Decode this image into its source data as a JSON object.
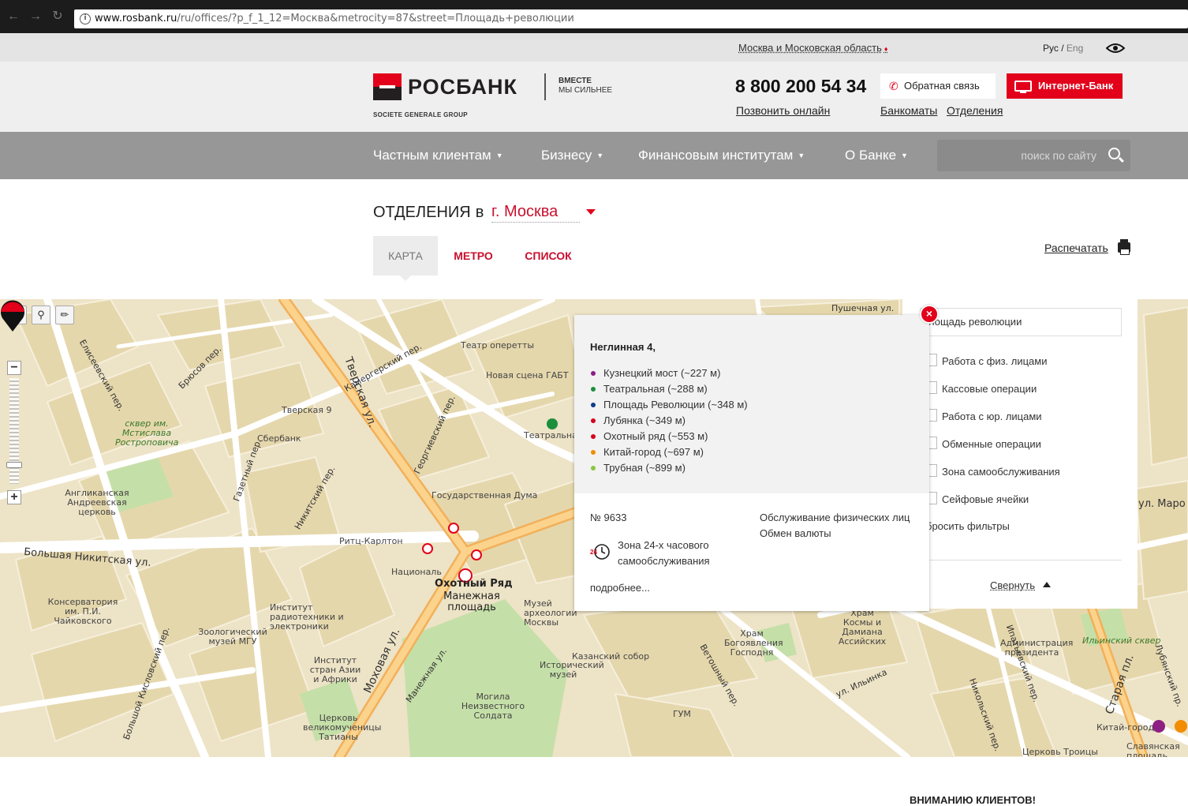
{
  "browser": {
    "url_host": "www.rosbank.ru",
    "url_path": "/ru/offices/?p_f_1_12=Москва&metrocity=87&street=Площадь+революции"
  },
  "topbar": {
    "region": "Москва и Московская область",
    "lang_ru": "Рус",
    "lang_sep": " / ",
    "lang_en": "Eng"
  },
  "header": {
    "logo_text": "РОСБАНК",
    "logo_sub": "SOCIETE GENERALE GROUP",
    "slogan_line1": "ВМЕСТЕ",
    "slogan_line2": "МЫ СИЛЬНЕЕ",
    "phone": "8 800 200 54 34",
    "call_online": "Позвонить онлайн",
    "callback": "Обратная связь",
    "internet_bank": "Интернет-Банк",
    "atms": "Банкоматы",
    "offices": "Отделения"
  },
  "nav": {
    "items": [
      "Частным клиентам",
      "Бизнесу",
      "Финансовым институтам",
      "О Банке"
    ],
    "search_placeholder": "поиск по сайту"
  },
  "page": {
    "title": "ОТДЕЛЕНИЯ",
    "title_in": "в",
    "city": "г. Москва",
    "tabs": [
      "КАРТА",
      "МЕТРО",
      "СПИСОК"
    ],
    "print": "Распечатать"
  },
  "balloon": {
    "address": "Неглинная 4,",
    "metro": [
      {
        "name": "Кузнецкий мост (~227 м)",
        "color": "#8e1f83"
      },
      {
        "name": "Театральная (~288 м)",
        "color": "#1c8f3c"
      },
      {
        "name": "Площадь Революции (~348 м)",
        "color": "#0f3d8c"
      },
      {
        "name": "Лубянка (~349 м)",
        "color": "#d6001c"
      },
      {
        "name": "Охотный ряд (~553 м)",
        "color": "#d6001c"
      },
      {
        "name": "Китай-город (~697 м)",
        "color": "#f28c00"
      },
      {
        "name": "Трубная (~899 м)",
        "color": "#8cc63f"
      }
    ],
    "number": "№ 9633",
    "services_1": "Обслуживание физических лиц",
    "services_2": "Обмен валюты",
    "zone": "Зона 24-х часового самообслуживания",
    "clock_label": "24",
    "more": "подробнее..."
  },
  "filter": {
    "search_value": "лощадь революции",
    "options": [
      "Работа с физ. лицами",
      "Кассовые операции",
      "Работа с юр. лицами",
      "Обменные операции",
      "Зона самообслуживания",
      "Сейфовые ячейки"
    ],
    "reset": "бросить фильтры",
    "collapse": "Свернуть"
  },
  "map": {
    "labels": [
      {
        "t": "Тверская ул.",
        "c": "street"
      },
      {
        "t": "Моховая ул.",
        "c": "street"
      },
      {
        "t": "Охотный Ряд",
        "c": "big"
      },
      {
        "t": "Манежная площадь",
        "c": "big"
      },
      {
        "t": "Государственная Дума",
        "c": ""
      },
      {
        "t": "Театр оперетты",
        "c": ""
      },
      {
        "t": "Новая сцена ГАБТ",
        "c": ""
      },
      {
        "t": "Театральная",
        "c": ""
      },
      {
        "t": "Сбербанк",
        "c": ""
      },
      {
        "t": "Тверская 9",
        "c": ""
      },
      {
        "t": "Ритц-Карлтон",
        "c": ""
      },
      {
        "t": "Националь",
        "c": ""
      },
      {
        "t": "Институт радиотехники и электроники",
        "c": ""
      },
      {
        "t": "Зоологический музей МГУ",
        "c": ""
      },
      {
        "t": "Консерватория им. П.И. Чайковского",
        "c": ""
      },
      {
        "t": "Англиканская Андреевская церковь",
        "c": ""
      },
      {
        "t": "сквер им. Мстислава Ростроповича",
        "c": ""
      },
      {
        "t": "Могила Неизвестного Солдата",
        "c": ""
      },
      {
        "t": "Казанский собор",
        "c": ""
      },
      {
        "t": "Исторический музей",
        "c": ""
      },
      {
        "t": "ГУМ",
        "c": ""
      },
      {
        "t": "Храм Богоявления Господня",
        "c": ""
      },
      {
        "t": "Храм Космы и Дамиана Ассийских",
        "c": ""
      },
      {
        "t": "Администрация президента",
        "c": ""
      },
      {
        "t": "Ильинский сквер",
        "c": ""
      },
      {
        "t": "Китай-город",
        "c": ""
      },
      {
        "t": "Славянская площадь",
        "c": ""
      },
      {
        "t": "Церковь Троицы",
        "c": ""
      },
      {
        "t": "Пушечная ул.",
        "c": "street"
      },
      {
        "t": "ул. Ильинка",
        "c": "street"
      },
      {
        "t": "Старая пл.",
        "c": "street"
      },
      {
        "t": "Лубянский пр.",
        "c": "street"
      },
      {
        "t": "Ветошный пер.",
        "c": "street"
      },
      {
        "t": "Никольский пер.",
        "c": "street"
      },
      {
        "t": "Ипатьевский пер.",
        "c": "street"
      },
      {
        "t": "Большая Никитская ул.",
        "c": "street"
      },
      {
        "t": "Большой Кисловский пер.",
        "c": "street"
      },
      {
        "t": "Георгиевский пер.",
        "c": "street"
      },
      {
        "t": "Камергерский пер.",
        "c": "street"
      },
      {
        "t": "Газетный пер.",
        "c": "street"
      },
      {
        "t": "Никитский пер.",
        "c": "street"
      },
      {
        "t": "Брюсов пер.",
        "c": "street"
      },
      {
        "t": "Елисеевский пер.",
        "c": "street"
      },
      {
        "t": "Манежная ул.",
        "c": "street"
      },
      {
        "t": "Институт стран Азии и Африки",
        "c": ""
      },
      {
        "t": "Церковь великомученицы Татианы",
        "c": ""
      },
      {
        "t": "Музей археологии Москвы",
        "c": ""
      },
      {
        "t": "ул. Маро",
        "c": "street"
      }
    ]
  }
}
